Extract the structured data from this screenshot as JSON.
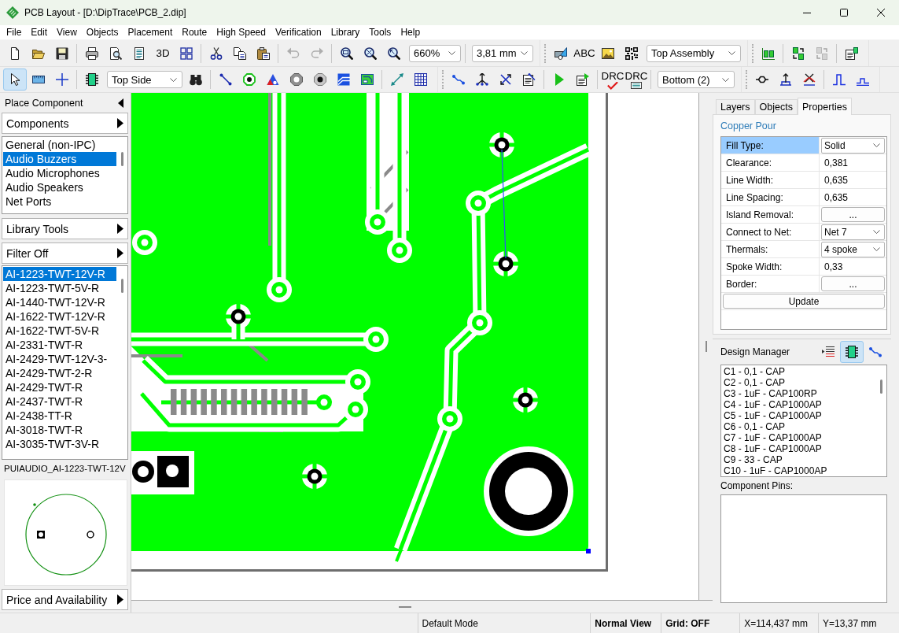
{
  "window": {
    "title": "PCB Layout - [D:\\DipTrace\\PCB_2.dip]"
  },
  "menu": [
    "File",
    "Edit",
    "View",
    "Objects",
    "Placement",
    "Route",
    "High Speed",
    "Verification",
    "Library",
    "Tools",
    "Help"
  ],
  "toolbars": [
    {
      "bands": [
        {
          "groups": [
            {
              "items": [
                {
                  "kind": "button",
                  "disabled": false
                },
                {
                  "kind": "button",
                  "disabled": false
                },
                {
                  "kind": "button",
                  "disabled": false
                }
              ]
            },
            {
              "items": [
                {
                  "kind": "button",
                  "disabled": false
                },
                {
                  "kind": "button",
                  "disabled": false
                },
                {
                  "kind": "button",
                  "disabled": false
                },
                {
                  "kind": "button",
                  "label": "3D",
                  "disabled": false
                },
                {
                  "kind": "button",
                  "disabled": false
                }
              ]
            },
            {
              "items": [
                {
                  "kind": "button",
                  "disabled": false
                },
                {
                  "kind": "button",
                  "disabled": false
                },
                {
                  "kind": "button",
                  "disabled": false
                }
              ]
            },
            {
              "items": [
                {
                  "kind": "button",
                  "disabled": true
                },
                {
                  "kind": "button",
                  "disabled": true
                }
              ]
            },
            {
              "items": [
                {
                  "kind": "button",
                  "disabled": false
                },
                {
                  "kind": "button",
                  "disabled": false
                },
                {
                  "kind": "button",
                  "disabled": false
                },
                {
                  "kind": "combo",
                  "value": "660%"
                }
              ]
            },
            {
              "items": [
                {
                  "kind": "combo",
                  "value": "3,81 mm"
                }
              ]
            }
          ]
        },
        {
          "groups": [
            {
              "items": [
                {
                  "kind": "button",
                  "disabled": false
                },
                {
                  "kind": "button",
                  "label": "ABC",
                  "disabled": false
                },
                {
                  "kind": "button",
                  "disabled": false
                },
                {
                  "kind": "button",
                  "disabled": false
                },
                {
                  "kind": "combo",
                  "value": "Top Assembly"
                }
              ]
            }
          ]
        },
        {
          "groups": [
            {
              "items": [
                {
                  "kind": "button",
                  "disabled": false
                }
              ]
            },
            {
              "items": [
                {
                  "kind": "button",
                  "disabled": false
                },
                {
                  "kind": "button",
                  "disabled": true
                }
              ]
            },
            {
              "items": [
                {
                  "kind": "button",
                  "disabled": false
                }
              ]
            }
          ]
        }
      ]
    },
    {
      "bands": [
        {
          "groups": [
            {
              "items": [
                {
                  "kind": "button",
                  "selected": true
                },
                {
                  "kind": "button",
                  "selected": false
                },
                {
                  "kind": "button",
                  "selected": false
                }
              ]
            },
            {
              "items": [
                {
                  "kind": "button"
                },
                {
                  "kind": "combo",
                  "value": "Top Side"
                },
                {
                  "kind": "button"
                }
              ]
            },
            {
              "items": [
                {
                  "kind": "button"
                },
                {
                  "kind": "button"
                },
                {
                  "kind": "button"
                },
                {
                  "kind": "button"
                },
                {
                  "kind": "button"
                },
                {
                  "kind": "button"
                },
                {
                  "kind": "button"
                }
              ]
            },
            {
              "items": [
                {
                  "kind": "button"
                },
                {
                  "kind": "button"
                }
              ]
            }
          ]
        },
        {
          "groups": [
            {
              "items": [
                {
                  "kind": "button"
                },
                {
                  "kind": "button"
                },
                {
                  "kind": "button"
                },
                {
                  "kind": "button"
                }
              ]
            },
            {
              "items": [
                {
                  "kind": "button"
                },
                {
                  "kind": "button"
                }
              ]
            },
            {
              "items": [
                {
                  "kind": "button",
                  "label": "DRC"
                },
                {
                  "kind": "button",
                  "label": "DRC"
                }
              ]
            },
            {
              "items": [
                {
                  "kind": "combo",
                  "value": "Bottom (2)"
                }
              ]
            }
          ]
        },
        {
          "groups": [
            {
              "items": [
                {
                  "kind": "button"
                },
                {
                  "kind": "button"
                },
                {
                  "kind": "button"
                }
              ]
            },
            {
              "items": [
                {
                  "kind": "button"
                },
                {
                  "kind": "button"
                }
              ]
            }
          ]
        }
      ]
    }
  ],
  "left_panel": {
    "title": "Place Component",
    "components_button": "Components",
    "categories": [
      {
        "label": "General (non-IPC)",
        "selected": false
      },
      {
        "label": "Audio Buzzers",
        "selected": true
      },
      {
        "label": "Audio Microphones",
        "selected": false
      },
      {
        "label": "Audio Speakers",
        "selected": false
      },
      {
        "label": "Net Ports",
        "selected": false
      }
    ],
    "library_tools_button": "Library Tools",
    "filter_button": "Filter Off",
    "parts": [
      {
        "label": "AI-1223-TWT-12V-R",
        "selected": true
      },
      {
        "label": "AI-1223-TWT-5V-R",
        "selected": false
      },
      {
        "label": "AI-1440-TWT-12V-R",
        "selected": false
      },
      {
        "label": "AI-1622-TWT-12V-R",
        "selected": false
      },
      {
        "label": "AI-1622-TWT-5V-R",
        "selected": false
      },
      {
        "label": "AI-2331-TWT-R",
        "selected": false
      },
      {
        "label": "AI-2429-TWT-12V-3-",
        "selected": false
      },
      {
        "label": "AI-2429-TWT-2-R",
        "selected": false
      },
      {
        "label": "AI-2429-TWT-R",
        "selected": false
      },
      {
        "label": "AI-2437-TWT-R",
        "selected": false
      },
      {
        "label": "AI-2438-TT-R",
        "selected": false
      },
      {
        "label": "AI-3018-TWT-R",
        "selected": false
      },
      {
        "label": "AI-3035-TWT-3V-R",
        "selected": false
      }
    ],
    "preview_title": "PUIAUDIO_AI-1223-TWT-12V",
    "price_button": "Price and Availability"
  },
  "right_panel": {
    "tabs": [
      {
        "label": "Layers",
        "selected": false
      },
      {
        "label": "Objects",
        "selected": false
      },
      {
        "label": "Properties",
        "selected": true
      }
    ],
    "section_title": "Copper Pour",
    "properties": [
      {
        "name": "Fill Type:",
        "kind": "dropdown",
        "value": "Solid",
        "selected": true
      },
      {
        "name": "Clearance:",
        "kind": "text",
        "value": "0,381",
        "selected": false
      },
      {
        "name": "Line Width:",
        "kind": "text",
        "value": "0,635",
        "selected": false
      },
      {
        "name": "Line Spacing:",
        "kind": "text",
        "value": "0,635",
        "selected": false
      },
      {
        "name": "Island Removal:",
        "kind": "button",
        "value": "...",
        "selected": false
      },
      {
        "name": "Connect to Net:",
        "kind": "dropdown",
        "value": "Net 7",
        "selected": false
      },
      {
        "name": "Thermals:",
        "kind": "dropdown",
        "value": "4 spoke",
        "selected": false
      },
      {
        "name": "Spoke Width:",
        "kind": "text",
        "value": "0,33",
        "selected": false
      },
      {
        "name": "Border:",
        "kind": "button",
        "value": "...",
        "selected": false
      }
    ],
    "update_button": "Update"
  },
  "design_manager": {
    "title": "Design Manager",
    "views": [
      {
        "selected": false
      },
      {
        "selected": true
      },
      {
        "selected": false
      }
    ],
    "items": [
      "C1 - 0,1 - CAP",
      "C2 - 0,1 - CAP",
      "C3 - 1uF - CAP100RP",
      "C4 - 1uF - CAP1000AP",
      "C5 - 1uF - CAP1000AP",
      "C6 - 0,1 - CAP",
      "C7 - 1uF - CAP1000AP",
      "C8 - 1uF - CAP1000AP",
      "C9 - 33 - CAP",
      "C10 - 1uF - CAP1000AP"
    ],
    "pins_label": "Component Pins:"
  },
  "status_bar": [
    {
      "text": "Default Mode",
      "bold": false
    },
    {
      "text": "Normal View",
      "bold": true
    },
    {
      "text": "Grid: OFF",
      "bold": true
    },
    {
      "text": "X=114,437 mm",
      "bold": false
    },
    {
      "text": "Y=13,37 mm",
      "bold": false
    }
  ]
}
